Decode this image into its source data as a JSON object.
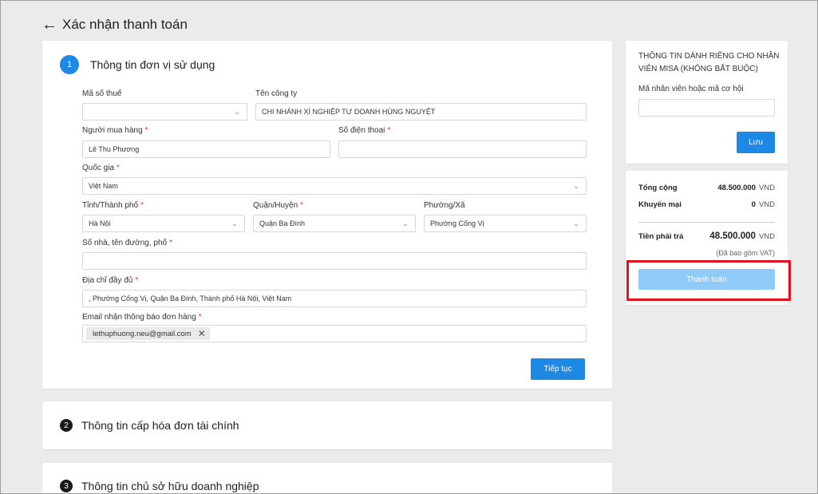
{
  "header": {
    "title": "Xác nhận thanh toán"
  },
  "step1": {
    "number": "1",
    "title": "Thông tin đơn vị sử dụng",
    "tax_code": {
      "label": "Mã số thuế",
      "value": ""
    },
    "company": {
      "label": "Tên công ty",
      "value": "CHI NHÁNH XÍ NGHIỆP TƯ DOANH HÙNG NGUYỆT"
    },
    "buyer": {
      "label": "Người mua hàng",
      "value": "Lê Thu Phương"
    },
    "phone": {
      "label": "Số điện thoại",
      "value": ""
    },
    "country": {
      "label": "Quốc gia",
      "value": "Việt Nam"
    },
    "province": {
      "label": "Tỉnh/Thành phố",
      "value": "Hà Nội"
    },
    "district": {
      "label": "Quận/Huyện",
      "value": "Quận Ba Đình"
    },
    "ward": {
      "label": "Phường/Xã",
      "value": "Phường Cống Vị"
    },
    "street": {
      "label": "Số nhà, tên đường, phố",
      "value": ""
    },
    "full_address": {
      "label": "Địa chỉ đầy đủ",
      "value": ", Phường Cống Vị, Quận Ba Đình, Thành phố Hà Nội, Việt Nam"
    },
    "email": {
      "label": "Email nhận thông báo đơn hàng",
      "chip": "lethuphuong.neu@gmail.com"
    },
    "continue_label": "Tiếp tục",
    "required_mark": "*"
  },
  "step2": {
    "number": "2",
    "title": "Thông tin cấp hóa đơn tài chính"
  },
  "step3": {
    "number": "3",
    "title": "Thông tin chủ sở hữu doanh nghiệp"
  },
  "staff": {
    "title": "THÔNG TIN DÀNH RIÊNG CHO NHÂN VIÊN MISA (KHÔNG BẮT BUỘC)",
    "label": "Mã nhân viên hoặc mã cơ hội",
    "value": "",
    "save_label": "Lưu"
  },
  "summary": {
    "total_label": "Tổng cộng",
    "total_value": "48.500.000",
    "discount_label": "Khuyến mại",
    "discount_value": "0",
    "pay_label": "Tiền phải trả",
    "pay_value": "48.500.000",
    "currency": "VND",
    "vat_note": "(Đã bao gồm VAT)",
    "pay_button": "Thanh toán"
  },
  "colors": {
    "primary": "#1e88e5",
    "primary_disabled": "#90caf9",
    "required": "#e53935",
    "highlight": "#e0141e"
  }
}
